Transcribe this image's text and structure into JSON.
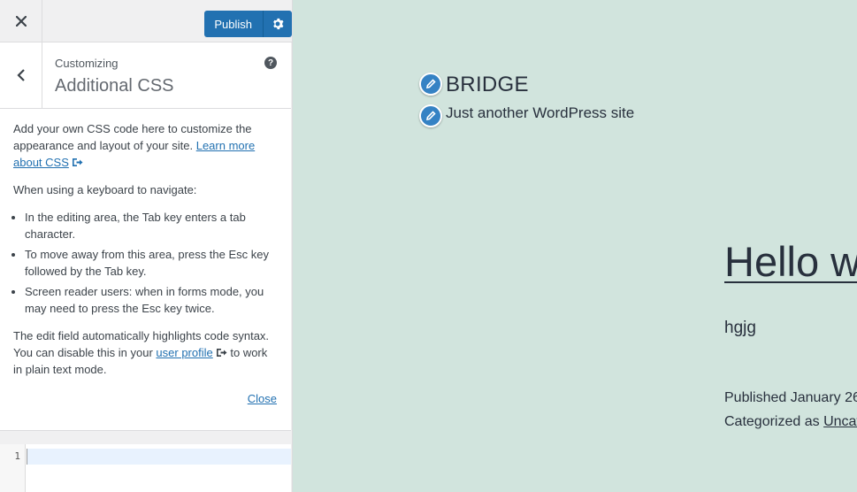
{
  "toolbar": {
    "close_label": "Close",
    "publish_label": "Publish"
  },
  "section": {
    "subtitle": "Customizing",
    "title": "Additional CSS",
    "help_symbol": "?"
  },
  "description": {
    "intro_text": "Add your own CSS code here to customize the appearance and layout of your site.",
    "learn_more_link": "Learn more about CSS",
    "keyboard_heading": "When using a keyboard to navigate:",
    "bullets": [
      "In the editing area, the Tab key enters a tab character.",
      "To move away from this area, press the Esc key followed by the Tab key.",
      "Screen reader users: when in forms mode, you may need to press the Esc key twice."
    ],
    "syntax_text_before": "The edit field automatically highlights code syntax. You can disable this in your",
    "user_profile_link": "user profile",
    "syntax_text_after": "to work in plain text mode.",
    "close_link": "Close"
  },
  "editor": {
    "line_number": "1",
    "value": ""
  },
  "preview": {
    "site_title": "BRIDGE",
    "site_description": "Just another WordPress site",
    "post_title": "Hello w",
    "post_body": "hgjg",
    "published_text": "Published January 26,",
    "categorized_prefix": "Categorized as",
    "category_link": "Uncat"
  },
  "colors": {
    "accent": "#2271b1",
    "preview_bg": "#d1e4dd",
    "edit_pen": "#3582c4"
  },
  "icons": {
    "close": "close-icon",
    "settings": "gear-icon",
    "back": "chevron-left-icon",
    "help": "help-icon",
    "external": "external-link-icon",
    "edit": "pencil-icon"
  }
}
